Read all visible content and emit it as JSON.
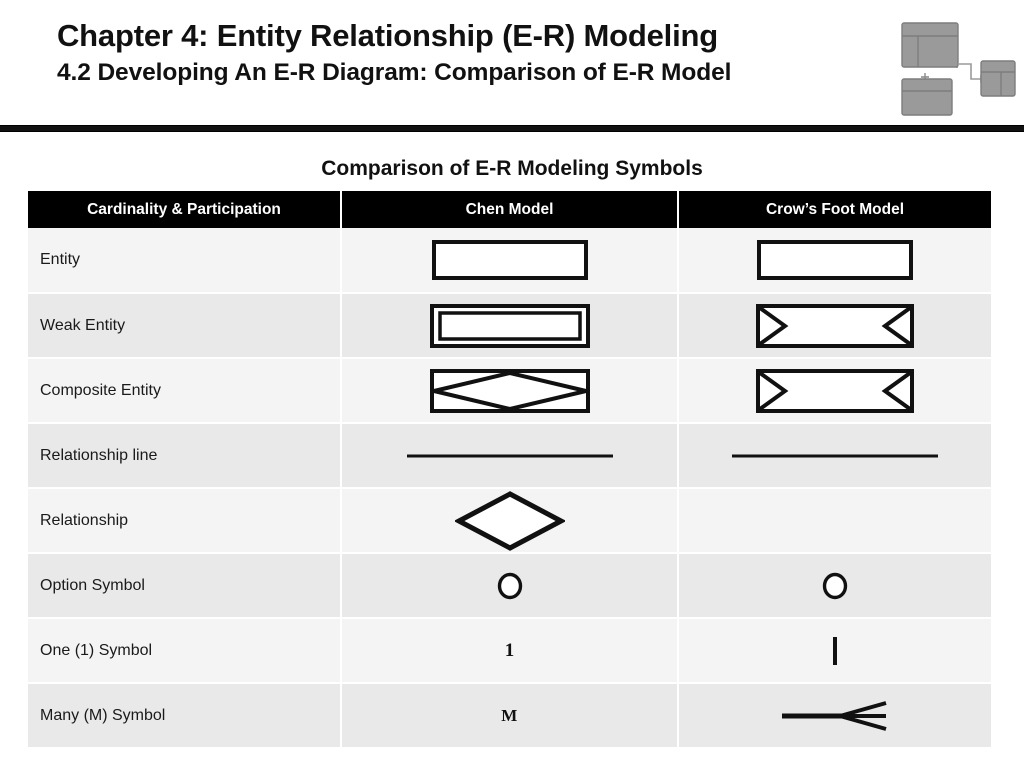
{
  "slide": {
    "title_line_1": "Chapter 4: Entity Relationship (E-R) Modeling",
    "title_line_2": "4.2 Developing An E-R Diagram: Comparison of E-R Model",
    "header_icon": "er-diagram-icon",
    "colors": {
      "header_rule": "#111111",
      "table_header_bg": "#000000",
      "table_header_fg": "#ffffff",
      "row_odd_bg": "#f4f4f4",
      "row_even_bg": "#e9e9e9",
      "symbol_stroke": "#111111",
      "icon_fill": "#9a9a9a"
    }
  },
  "table": {
    "caption": "Comparison of E-R Modeling Symbols",
    "columns": [
      {
        "key": "label",
        "header": "Cardinality & Participation"
      },
      {
        "key": "chen",
        "header": "Chen Model"
      },
      {
        "key": "crow",
        "header": "Crow’s Foot Model"
      }
    ],
    "rows": [
      {
        "label": "Entity",
        "chen_symbol": "rectangle",
        "crow_symbol": "rectangle"
      },
      {
        "label": "Weak Entity",
        "chen_symbol": "double-rectangle",
        "crow_symbol": "rectangle-with-corner-diagonals"
      },
      {
        "label": "Composite Entity",
        "chen_symbol": "rectangle-with-inscribed-diamond",
        "crow_symbol": "rectangle-with-corner-diagonals"
      },
      {
        "label": "Relationship line",
        "chen_symbol": "horizontal-line",
        "crow_symbol": "horizontal-line"
      },
      {
        "label": "Relationship",
        "chen_symbol": "diamond",
        "crow_symbol": "none"
      },
      {
        "label": "Option Symbol",
        "chen_symbol": "open-circle",
        "crow_symbol": "open-circle"
      },
      {
        "label": "One (1) Symbol",
        "chen_symbol": "text-1",
        "chen_text": "1",
        "crow_symbol": "vertical-tick"
      },
      {
        "label": "Many (M) Symbol",
        "chen_symbol": "text-M",
        "chen_text": "M",
        "crow_symbol": "crows-foot"
      }
    ]
  }
}
